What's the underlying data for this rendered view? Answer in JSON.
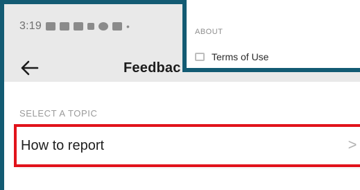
{
  "status_bar": {
    "time": "3:19",
    "icons": [
      "settings-icon",
      "gallery-icon",
      "message-icon",
      "tiktok-icon",
      "notification-icon",
      "linkedin-icon",
      "more-dot-icon"
    ],
    "dot": "•"
  },
  "appbar": {
    "back_icon": "back-arrow-icon",
    "title": "Feedbac"
  },
  "content": {
    "section_label": "SELECT A TOPIC",
    "topic": {
      "label": "How to report",
      "chevron": ">"
    }
  },
  "overlay": {
    "section": "ABOUT",
    "item": {
      "icon": "document-icon",
      "label": "Terms of Use"
    }
  },
  "colors": {
    "frame": "#135b73",
    "highlight": "#e1131b",
    "status_bg": "#e9e9e9"
  }
}
